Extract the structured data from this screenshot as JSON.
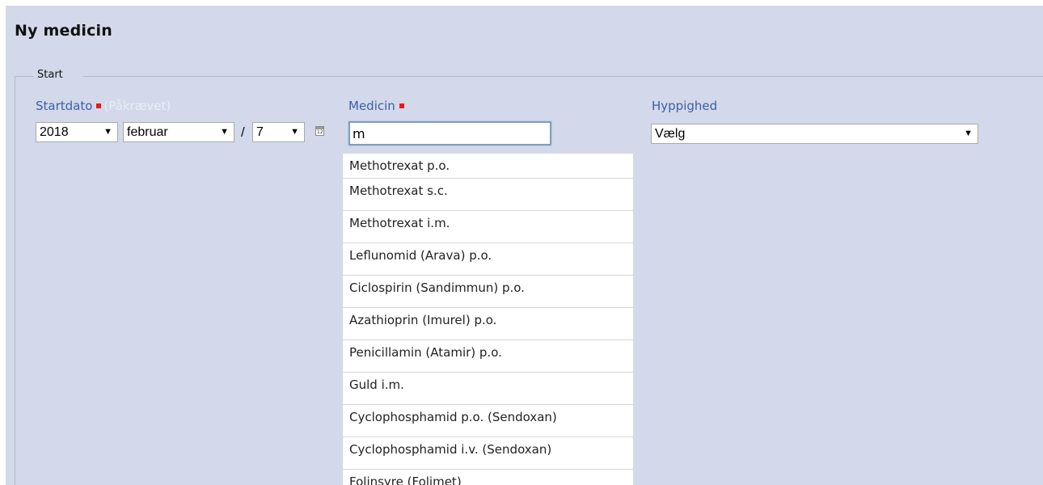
{
  "page": {
    "title": "Ny medicin"
  },
  "fieldset": {
    "legend": "Start"
  },
  "startdate": {
    "label": "Startdato",
    "required_hint": "(Påkrævet)",
    "year": "2018",
    "separator1": "/",
    "month": "februar",
    "separator2": "/",
    "day": "7",
    "calendar_icon": "calendar-icon"
  },
  "medicine": {
    "label": "Medicin",
    "input_value": "m",
    "suggestions": [
      "Methotrexat p.o.",
      "Methotrexat s.c.",
      "Methotrexat i.m.",
      "Leflunomid (Arava) p.o.",
      "Ciclospirin (Sandimmun) p.o.",
      "Azathioprin (Imurel) p.o.",
      "Penicillamin (Atamir) p.o.",
      "Guld i.m.",
      "Cyclophosphamid p.o. (Sendoxan)",
      "Cyclophosphamid i.v. (Sendoxan)",
      "Folinsyre (Folimet)"
    ]
  },
  "frequency": {
    "label": "Hyppighed",
    "selected": "Vælg"
  },
  "colors": {
    "panel_bg": "#d3d9ea",
    "label_blue": "#3d5ea8",
    "required_red": "#e81a1a"
  }
}
